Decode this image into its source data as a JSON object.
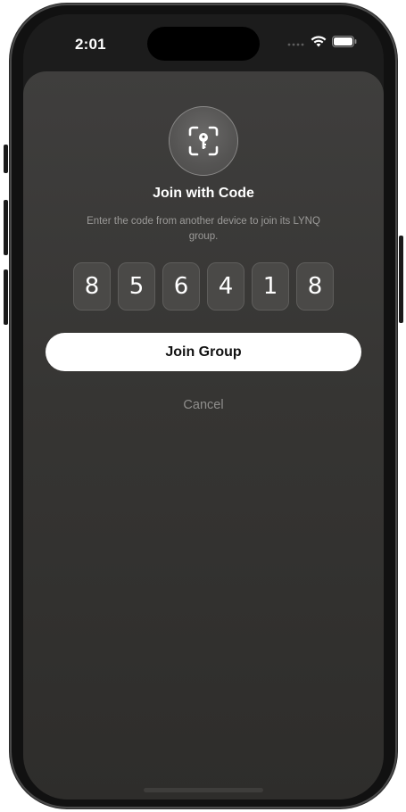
{
  "status_bar": {
    "time": "2:01"
  },
  "icons": {
    "status": [
      "signal-icon",
      "wifi-icon",
      "battery-icon"
    ],
    "header": "key-scan-icon"
  },
  "dialog": {
    "title": "Join with Code",
    "subtitle": "Enter the code from another device to join its LYNQ group.",
    "code_digits": [
      "8",
      "5",
      "6",
      "4",
      "1",
      "8"
    ],
    "join_label": "Join Group",
    "cancel_label": "Cancel"
  },
  "colors": {
    "sheet_background": "#3a3937",
    "button_background": "#ffffff",
    "button_text": "#111111",
    "digit_box": "#4a4947"
  }
}
